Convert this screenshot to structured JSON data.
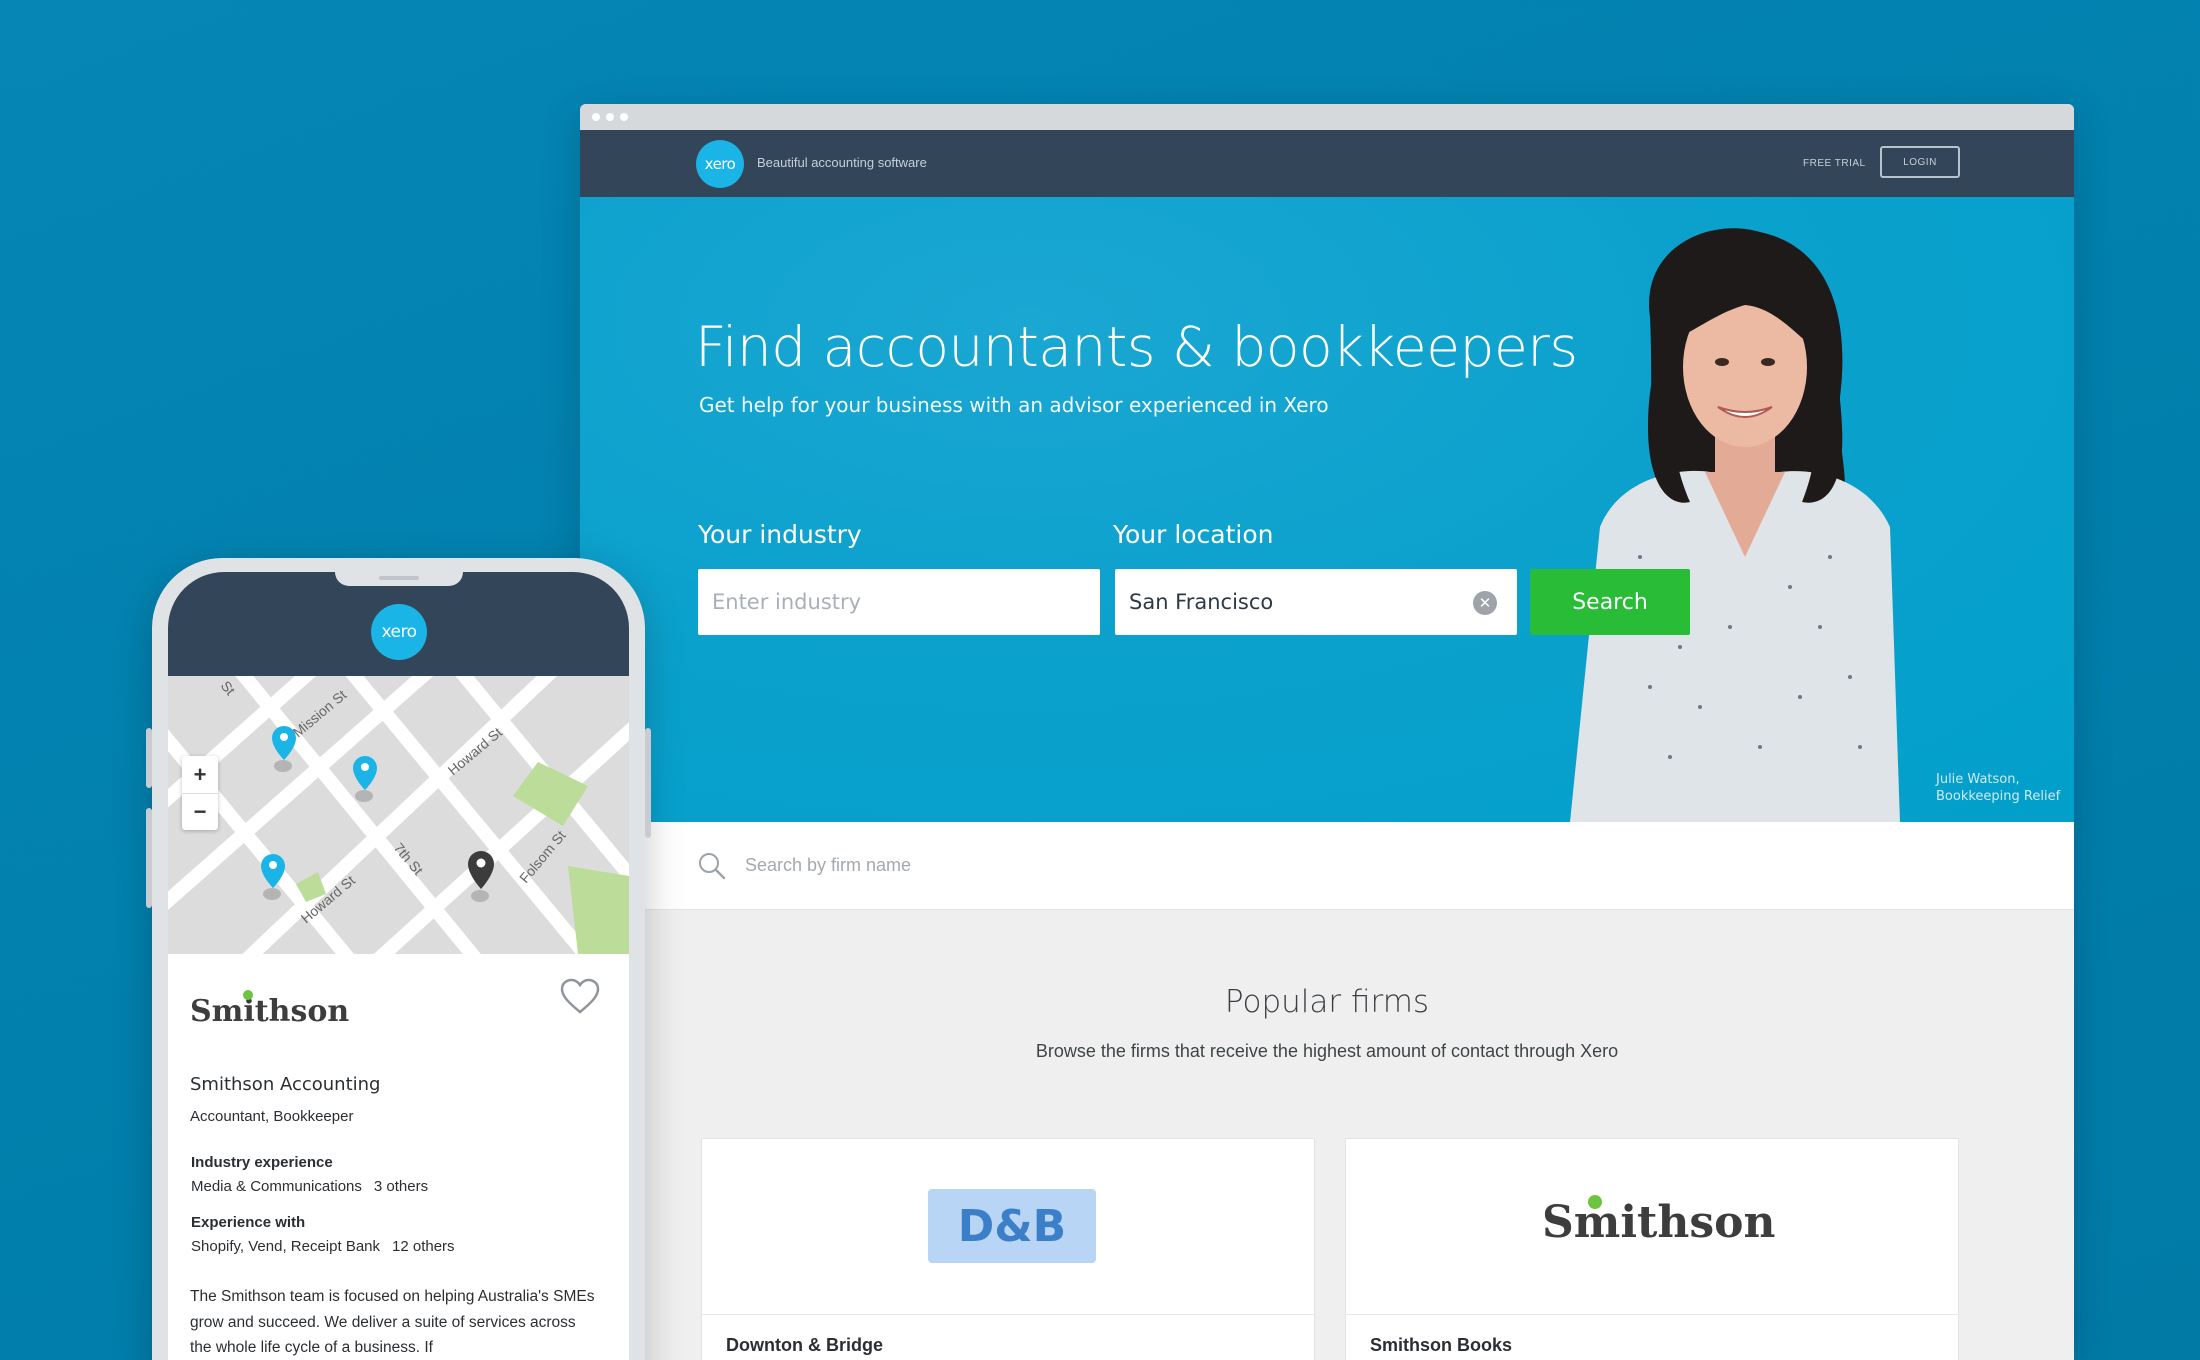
{
  "site": {
    "logo_text": "xero",
    "tagline": "Beautiful accounting software",
    "nav": {
      "free_trial": "FREE TRIAL",
      "login": "LOGIN"
    }
  },
  "hero": {
    "title": "Find accountants & bookkeepers",
    "subtitle": "Get help for your business with an advisor experienced in Xero",
    "industry_label": "Your industry",
    "industry_placeholder": "Enter industry",
    "location_label": "Your location",
    "location_value": "San Francisco",
    "search_button": "Search",
    "caption_name": "Julie Watson,",
    "caption_company": "Bookkeeping Relief"
  },
  "firm_search": {
    "placeholder": "Search by firm name"
  },
  "popular": {
    "title": "Popular firms",
    "subtitle": "Browse the firms that receive the highest amount of contact through Xero",
    "firms": [
      {
        "logo_text": "D&B",
        "name": "Downton & Bridge"
      },
      {
        "logo_text": "Smithson",
        "name": "Smithson Books"
      }
    ]
  },
  "mobile": {
    "logo_text": "xero",
    "map": {
      "streets": [
        "Mission St",
        "Howard St",
        "Howard St",
        "7th St",
        "Folsom St",
        "St"
      ],
      "zoom_in": "+",
      "zoom_out": "−"
    },
    "firm": {
      "logo_text": "Smithson",
      "name": "Smithson Accounting",
      "type": "Accountant, Bookkeeper",
      "industry_label": "Industry experience",
      "industry_value": "Media & Communications",
      "industry_more": "3 others",
      "experience_label": "Experience with",
      "experience_value": "Shopify, Vend, Receipt Bank",
      "experience_more": "12 others",
      "description": "The Smithson team is focused on helping Australia's SMEs grow and succeed. We deliver a suite of services across the whole life cycle of a business. If"
    }
  },
  "colors": {
    "background": "#0184b1",
    "nav": "#324559",
    "accent": "#1ab4e7",
    "search": "#29bd37",
    "hero": "#0ca1cd"
  }
}
